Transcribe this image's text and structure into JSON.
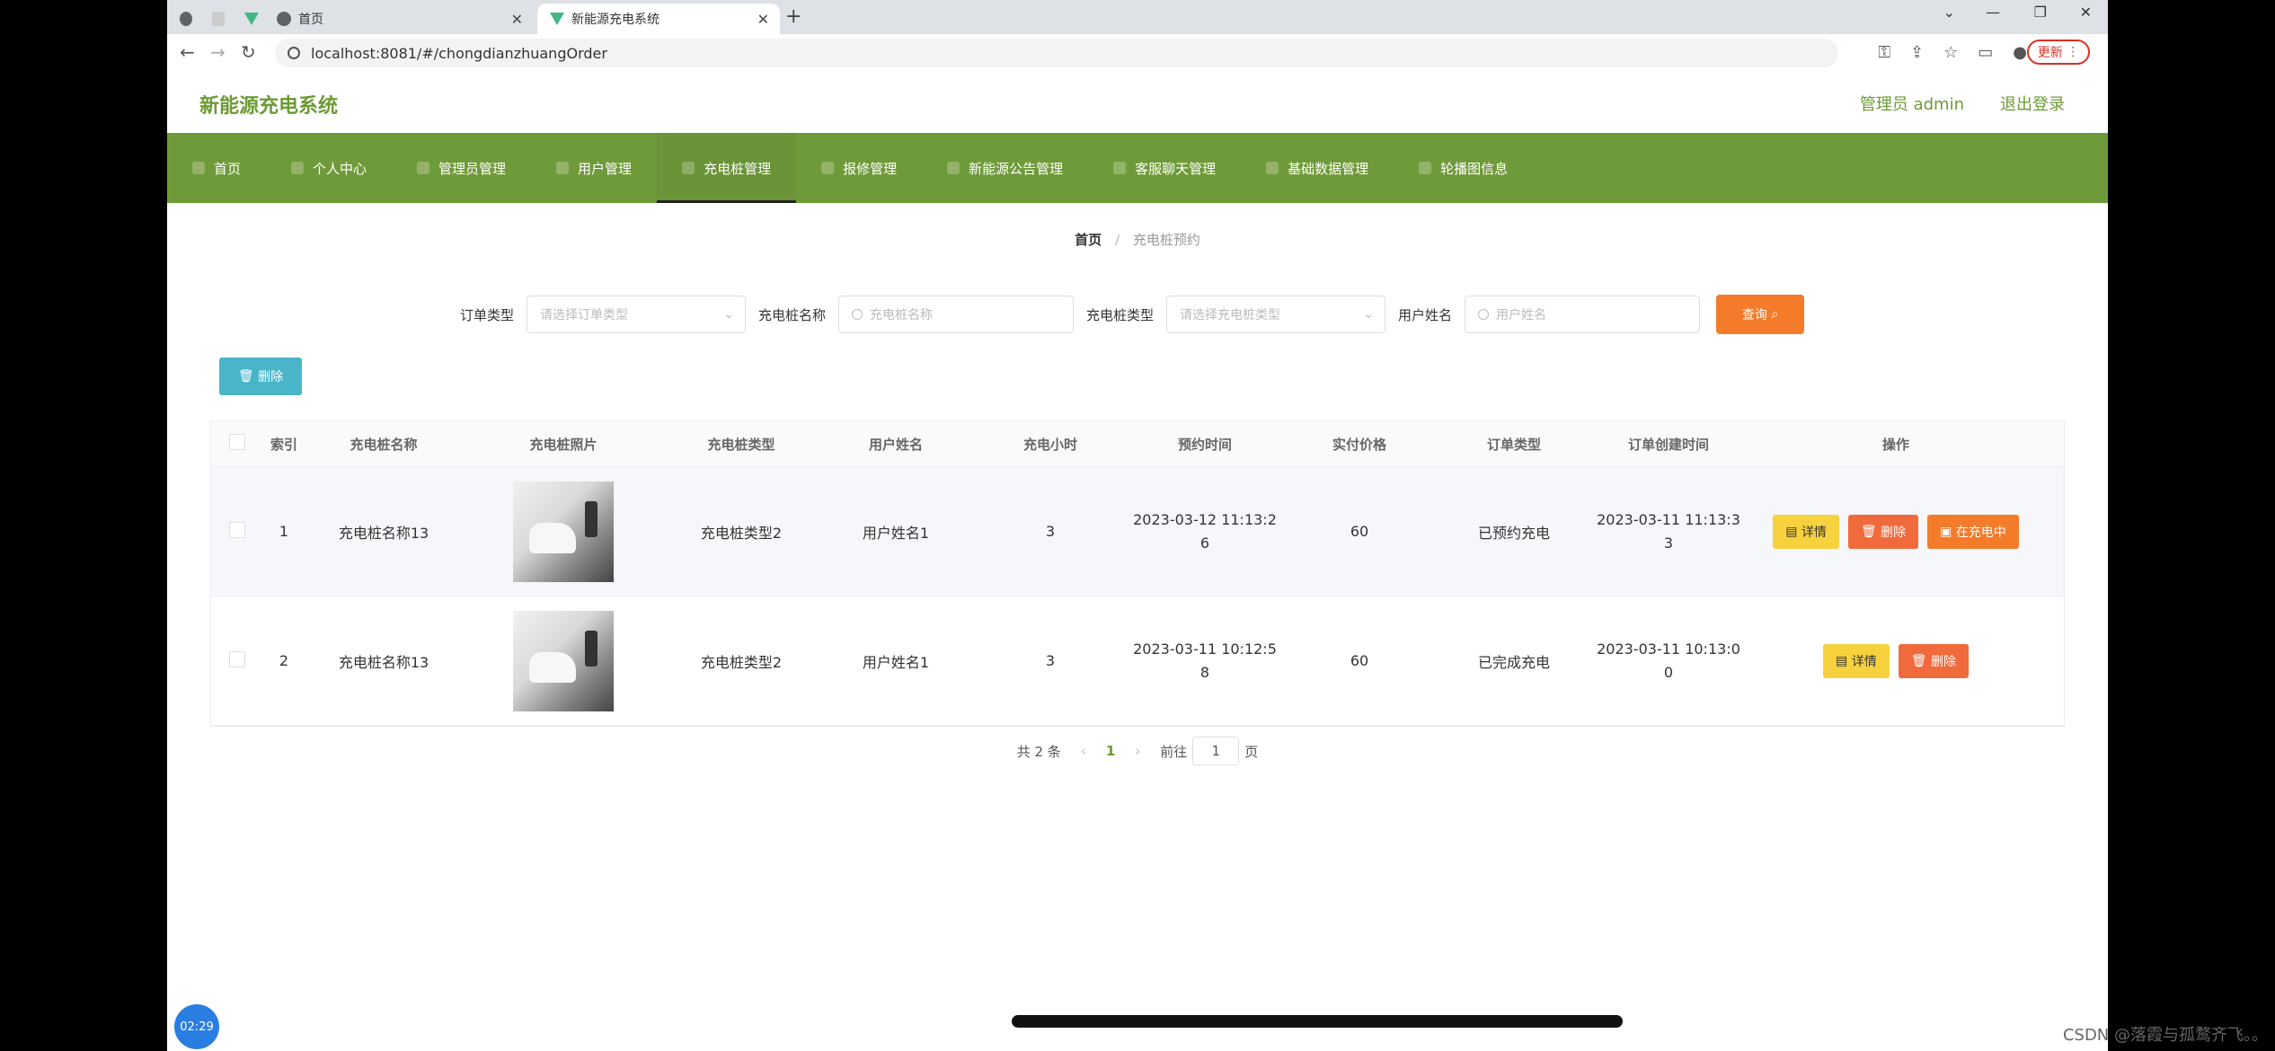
{
  "browser": {
    "tabs": [
      {
        "label": "",
        "icon": "globe-icon"
      },
      {
        "label": "",
        "icon": "page-icon"
      },
      {
        "label": "",
        "icon": "vue-icon"
      },
      {
        "label": "首页",
        "icon": "globe-icon"
      },
      {
        "label": "新能源充电系统",
        "icon": "vue-icon",
        "active": true
      }
    ],
    "url": "localhost:8081/#/chongdianzhuangOrder",
    "update_label": "更新"
  },
  "app": {
    "title": "新能源充电系统",
    "admin_label": "管理员 admin",
    "logout_label": "退出登录",
    "nav": [
      {
        "label": "首页"
      },
      {
        "label": "个人中心"
      },
      {
        "label": "管理员管理"
      },
      {
        "label": "用户管理"
      },
      {
        "label": "充电桩管理",
        "active": true
      },
      {
        "label": "报修管理"
      },
      {
        "label": "新能源公告管理"
      },
      {
        "label": "客服聊天管理"
      },
      {
        "label": "基础数据管理"
      },
      {
        "label": "轮播图信息"
      }
    ]
  },
  "breadcrumb": {
    "home": "首页",
    "separator": "/",
    "current": "充电桩预约"
  },
  "filters": {
    "order_type_label": "订单类型",
    "order_type_placeholder": "请选择订单类型",
    "pile_name_label": "充电桩名称",
    "pile_name_placeholder": "充电桩名称",
    "pile_type_label": "充电桩类型",
    "pile_type_placeholder": "请选择充电桩类型",
    "user_name_label": "用户姓名",
    "user_name_placeholder": "用户姓名",
    "query_label": "查询"
  },
  "toolbar": {
    "delete_label": "删除"
  },
  "table": {
    "headers": [
      "索引",
      "充电桩名称",
      "充电桩照片",
      "充电桩类型",
      "用户姓名",
      "充电小时",
      "预约时间",
      "实付价格",
      "订单类型",
      "订单创建时间",
      "操作"
    ],
    "rows": [
      {
        "index": "1",
        "name": "充电桩名称13",
        "type": "充电桩类型2",
        "user": "用户姓名1",
        "hours": "3",
        "reserve_time_a": "2023-03-12 11:13:2",
        "reserve_time_b": "6",
        "price": "60",
        "order_type": "已预约充电",
        "created_a": "2023-03-11 11:13:3",
        "created_b": "3",
        "actions": {
          "detail": "详情",
          "delete": "删除",
          "charging": "在充电中"
        }
      },
      {
        "index": "2",
        "name": "充电桩名称13",
        "type": "充电桩类型2",
        "user": "用户姓名1",
        "hours": "3",
        "reserve_time_a": "2023-03-11 10:12:5",
        "reserve_time_b": "8",
        "price": "60",
        "order_type": "已完成充电",
        "created_a": "2023-03-11 10:13:0",
        "created_b": "0",
        "actions": {
          "detail": "详情",
          "delete": "删除"
        }
      }
    ]
  },
  "pagination": {
    "total": "共 2 条",
    "current_page": "1",
    "goto_label": "前往",
    "goto_value": "1",
    "page_suffix": "页"
  },
  "overlay": {
    "clock": "02:29",
    "watermark": "CSDN @落霞与孤鹜齐飞。。"
  },
  "colors": {
    "brand_green": "#6f9a39",
    "query_orange": "#f47b2a",
    "delete_teal": "#49b5c9",
    "detail_yellow": "#f7d23e",
    "delete_red": "#f16a3c"
  }
}
